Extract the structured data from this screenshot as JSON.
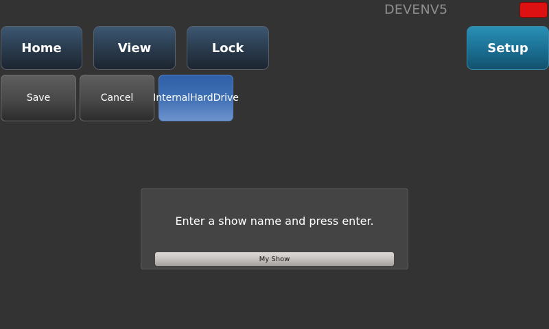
{
  "header": {
    "device_name": "DEVENV5",
    "status_color": "#dd1111"
  },
  "nav": {
    "home_label": "Home",
    "view_label": "View",
    "lock_label": "Lock",
    "setup_label": "Setup"
  },
  "actions": {
    "save_label": "Save",
    "cancel_label": "Cancel",
    "drive_label_line1": "Internal",
    "drive_label_line2": "HardDrive"
  },
  "dialog": {
    "prompt": "Enter a show name and press enter.",
    "input_value": "My Show"
  },
  "colors": {
    "background": "#333333",
    "nav_button": "#2a3c4f",
    "setup_button": "#1a6f93",
    "drive_button": "#3f6fb4",
    "status_indicator": "#dd1111"
  }
}
